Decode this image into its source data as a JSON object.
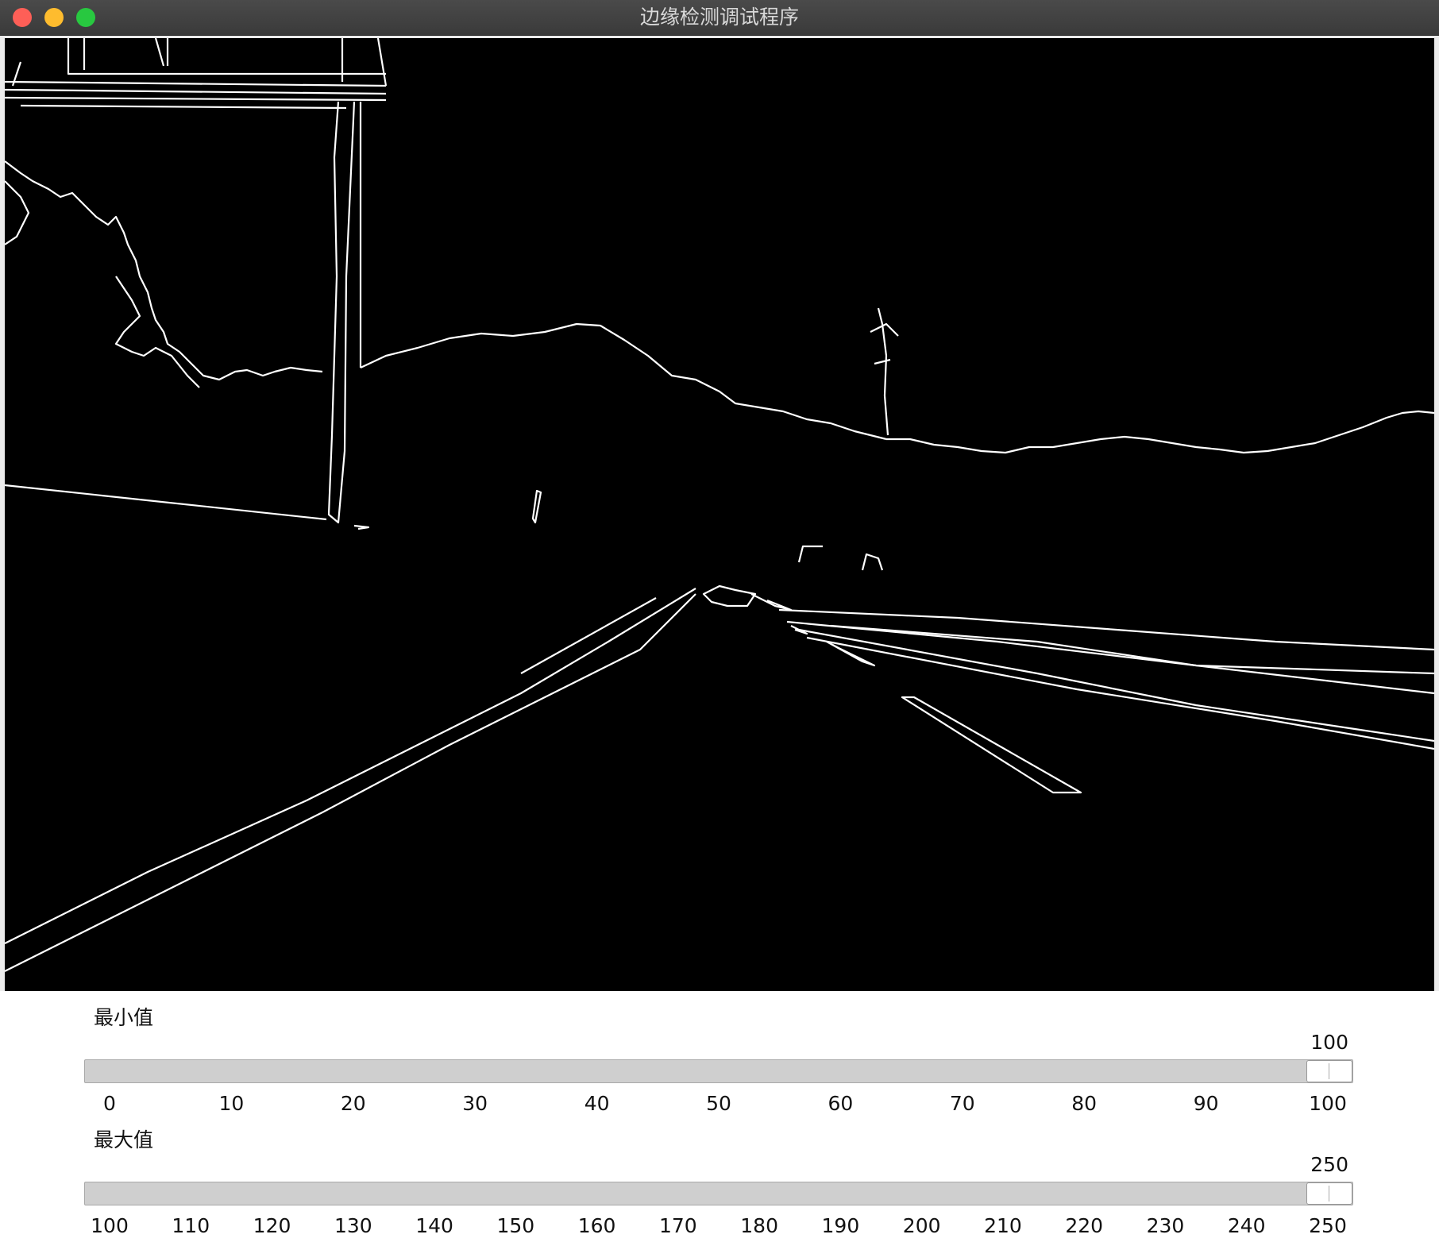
{
  "window": {
    "title": "边缘检测调试程序"
  },
  "colors": {
    "edge": "#ffffff",
    "background": "#000000",
    "track": "#cfcfcf"
  },
  "sliders": {
    "min": {
      "label": "最小值",
      "value": "100",
      "range": [
        0,
        100
      ],
      "ticks": [
        "0",
        "10",
        "20",
        "30",
        "40",
        "50",
        "60",
        "70",
        "80",
        "90",
        "100"
      ]
    },
    "max": {
      "label": "最大值",
      "value": "250",
      "range": [
        100,
        250
      ],
      "ticks": [
        "100",
        "110",
        "120",
        "130",
        "140",
        "150",
        "160",
        "170",
        "180",
        "190",
        "200",
        "210",
        "220",
        "230",
        "240",
        "250"
      ]
    }
  }
}
